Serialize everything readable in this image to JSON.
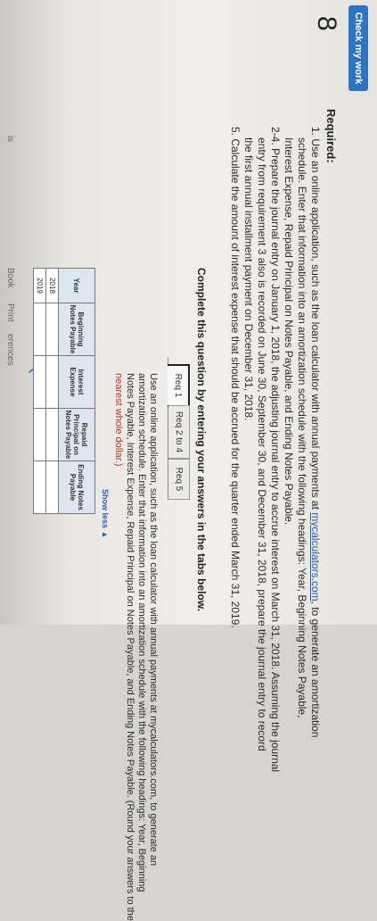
{
  "header": {
    "check_label": "Check my work",
    "question_number": "8"
  },
  "sidebar": {
    "labels": [
      "is",
      "Book",
      "Print",
      "erences"
    ]
  },
  "required": {
    "title": "Required:",
    "lines": [
      "1. Use an online application, such as the loan calculator with annual payments at mycalculators.com, to generate an amortization",
      "schedule. Enter that information into an amortization schedule with the following headings: Year, Beginning Notes Payable,",
      "Interest Expense, Repaid Principal on Notes Payable, and Ending Notes Payable.",
      "2-4. Prepare the journal entry on January 1, 2018, the adjusting journal entry to accrue interest on March 31, 2018. Assuming the journal",
      "entry from requirement 3 also is recorded on June 30, September 30, and December 31, 2018, prepare the journal entry to record",
      "the first annual installment payment on December 31, 2018.",
      "5. Calculate the amount of interest expense that should be accrued for the quarter ended March 31, 2019."
    ],
    "link_text": "mycalculators.com"
  },
  "instructions": "Complete this question by entering your answers in the tabs below.",
  "tabs": [
    "Req 1",
    "Req 2 to 4",
    "Req 5"
  ],
  "panel": {
    "lines": [
      "Use an online application, such as the loan calculator with annual payments at mycalculators.com, to generate an",
      "amortization schedule. Enter that information into an amortization schedule with the following headings: Year, Beginning",
      "Notes Payable, Interest Expense, Repaid Principal on Notes Payable, and Ending Notes Payable. (Round your answers to the",
      "nearest whole dollar.)"
    ],
    "show_less": "Show less ▲"
  },
  "table": {
    "headers": [
      "Year",
      "Beginning Notes Payable",
      "Interest Expense",
      "Repaid Principal on Notes Payable",
      "Ending Notes Payable"
    ],
    "rows": [
      {
        "year": "2018",
        "beginning": "",
        "interest": "",
        "repaid": "",
        "ending": ""
      },
      {
        "year": "2019",
        "beginning": "",
        "interest": "",
        "repaid": "",
        "ending": ""
      }
    ]
  },
  "colors": {
    "accent": "#2f74c0",
    "link": "#2a5db0",
    "warning_text": "#b5352e"
  }
}
